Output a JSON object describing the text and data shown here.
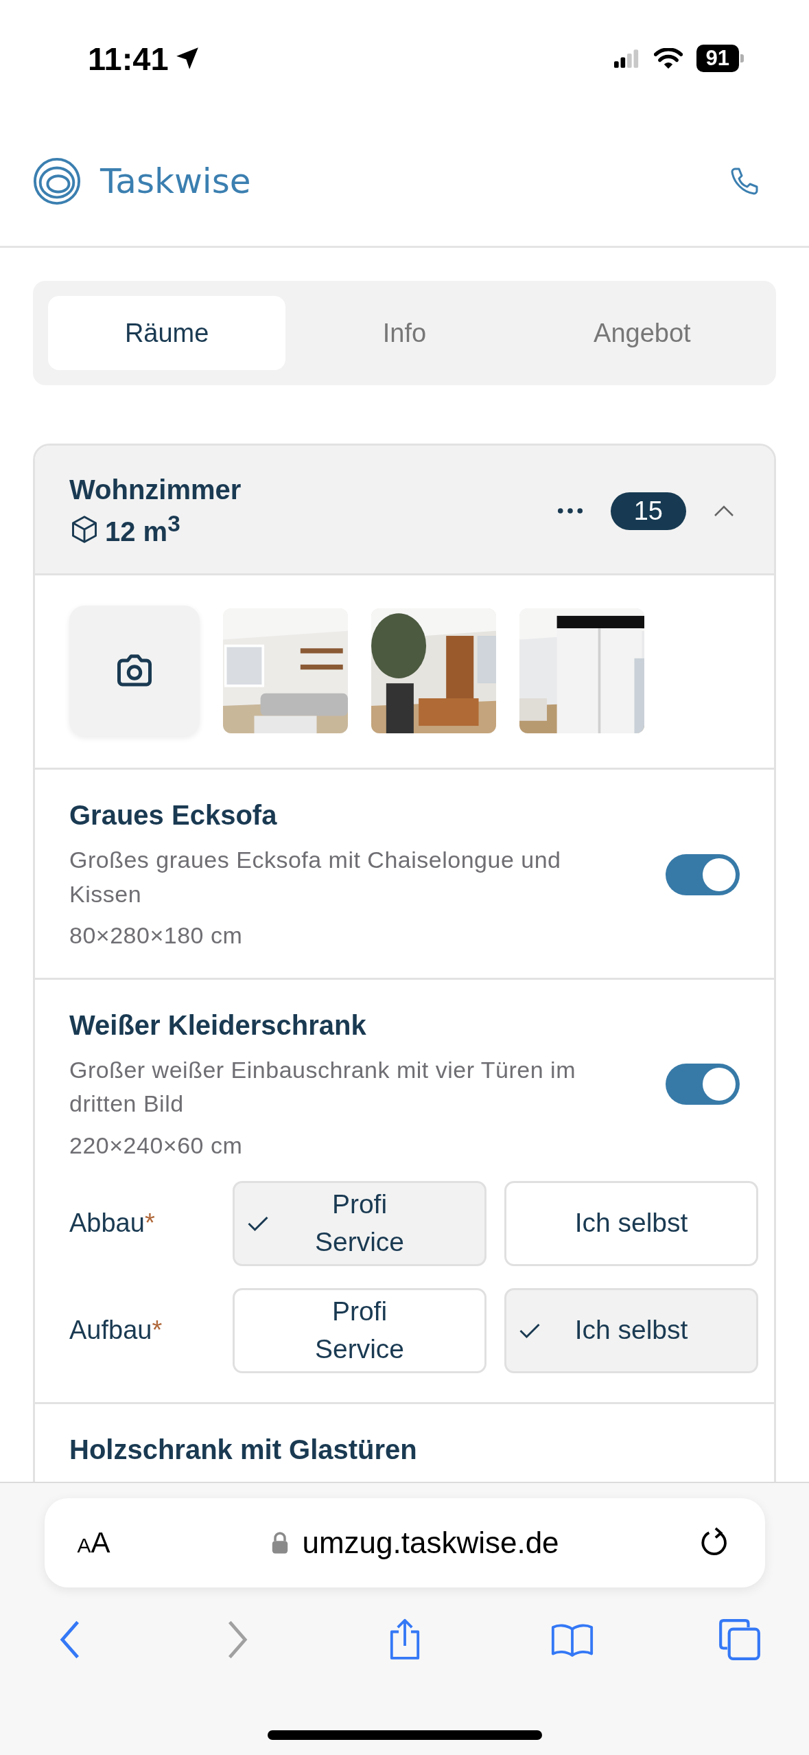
{
  "status_bar": {
    "time": "11:41",
    "battery": "91"
  },
  "header": {
    "brand": "Taskwise"
  },
  "tabs": [
    {
      "label": "Räume",
      "selected": true
    },
    {
      "label": "Info",
      "selected": false
    },
    {
      "label": "Angebot",
      "selected": false
    }
  ],
  "room": {
    "name": "Wohnzimmer",
    "volume": "12 m$^{3}$",
    "count": "15",
    "expanded": true,
    "photos": [
      {
        "kind": "add"
      },
      {
        "kind": "picture"
      },
      {
        "kind": "picture"
      },
      {
        "kind": "picture"
      }
    ],
    "items": [
      {
        "name": "Graues Ecksofa",
        "description": "Großes graues Ecksofa mit Chaiselongue und Kissen",
        "dimensions": "80×280×180 cm",
        "on": true
      },
      {
        "name": "Weißer Kleiderschrank",
        "description": "Großer weißer Einbauschrank mit vier Türen im dritten Bild",
        "dimensions": "220×240×60 cm",
        "on": true,
        "options": [
          {
            "label": "Abbau",
            "required_mark": "*",
            "choices": [
              {
                "label": "Profi Service",
                "selected": true
              },
              {
                "label": "Ich selbst",
                "selected": false
              }
            ]
          },
          {
            "label": "Aufbau",
            "required_mark": "*",
            "choices": [
              {
                "label": "Profi Service",
                "selected": false
              },
              {
                "label": "Ich selbst",
                "selected": true
              }
            ]
          }
        ]
      },
      {
        "name": "Holzschrank mit Glastüren"
      }
    ]
  },
  "browser": {
    "text_size": "AA",
    "url": "umzug.taskwise.de"
  }
}
